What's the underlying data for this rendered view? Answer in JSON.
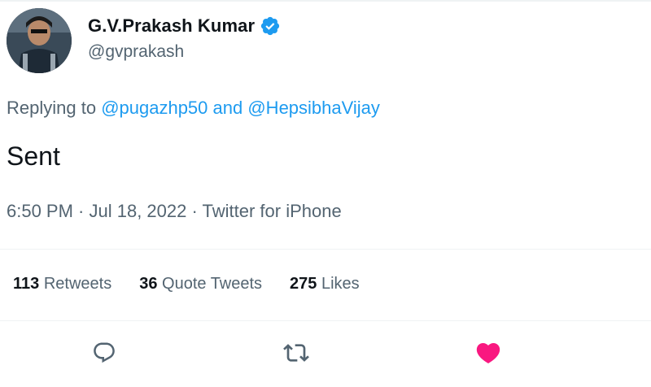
{
  "author": {
    "display_name": "G.V.Prakash Kumar",
    "handle": "@gvprakash",
    "verified_icon": "verified-badge-icon",
    "avatar_icon": "profile-avatar"
  },
  "reply": {
    "prefix": "Replying to ",
    "mention_1": "@pugazhp50",
    "joiner": " and ",
    "mention_2": "@HepsibhaVijay"
  },
  "tweet": {
    "text": "Sent"
  },
  "meta": {
    "time": "6:50 PM",
    "separator": " · ",
    "date": "Jul 18, 2022",
    "source": "Twitter for iPhone"
  },
  "stats": {
    "retweets_count": "113",
    "retweets_label": " Retweets",
    "quotes_count": "36",
    "quotes_label": " Quote Tweets",
    "likes_count": "275",
    "likes_label": " Likes"
  },
  "actions": {
    "reply_icon": "reply-icon",
    "retweet_icon": "retweet-icon",
    "like_icon": "heart-icon",
    "like_state": "liked"
  },
  "colors": {
    "accent": "#1d9bf0",
    "like": "#f91880",
    "secondary_text": "#536471",
    "divider": "#eff3f4"
  }
}
